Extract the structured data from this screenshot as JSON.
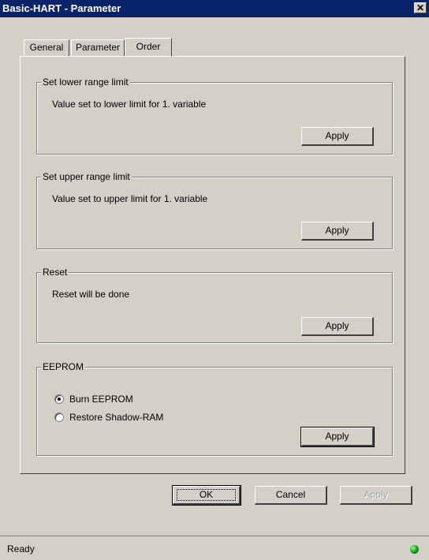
{
  "window": {
    "title": "Basic-HART - Parameter",
    "close_glyph": "✕"
  },
  "tabs": [
    {
      "label": "General",
      "active": false
    },
    {
      "label": "Parameter",
      "active": false
    },
    {
      "label": "Order",
      "active": true
    }
  ],
  "groups": {
    "lower": {
      "legend": "Set lower range limit",
      "description": "Value set to lower limit for  1. variable",
      "apply_label": "Apply"
    },
    "upper": {
      "legend": "Set upper range limit",
      "description": "Value set to upper limit for 1. variable",
      "apply_label": "Apply"
    },
    "reset": {
      "legend": "Reset",
      "description": "Reset will be done",
      "apply_label": "Apply"
    },
    "eeprom": {
      "legend": "EEPROM",
      "options": [
        {
          "label": "Burn EEPROM",
          "selected": true
        },
        {
          "label": "Restore Shadow-RAM",
          "selected": false
        }
      ],
      "apply_label": "Apply"
    }
  },
  "dialog_buttons": {
    "ok": "OK",
    "cancel": "Cancel",
    "apply": "Apply",
    "apply_disabled": true
  },
  "status": {
    "text": "Ready",
    "icon": "status-ok-icon",
    "icon_color": "#1a9a1a"
  },
  "colors": {
    "titlebar": "#0a246a",
    "face": "#d4d0c8"
  }
}
